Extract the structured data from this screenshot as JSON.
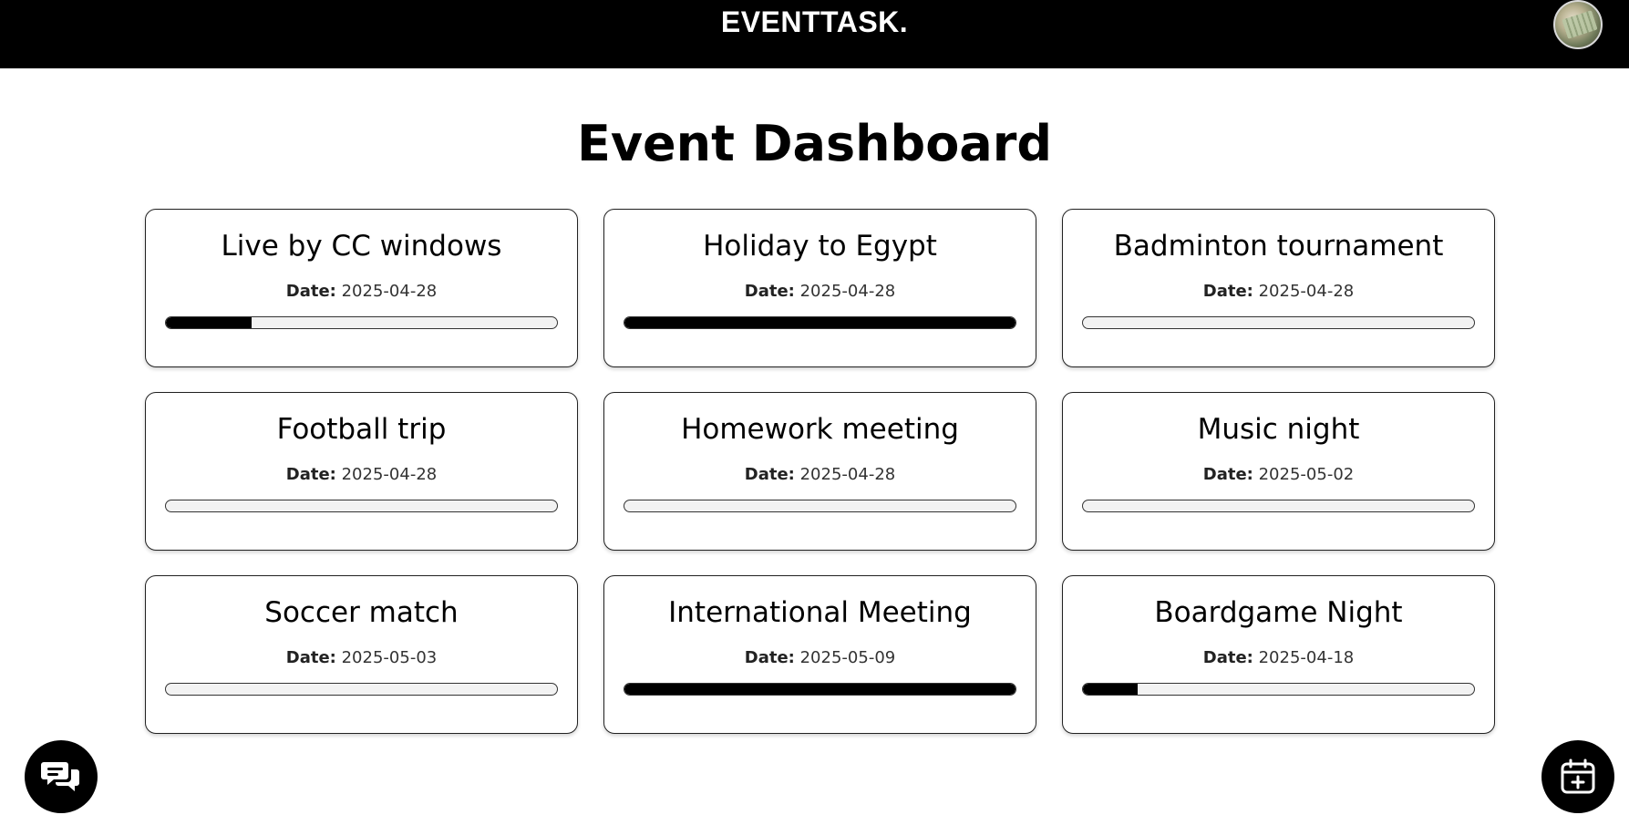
{
  "header": {
    "brand": "EVENTTASK.",
    "avatar_icon": "user-avatar-icon",
    "background": "#000000"
  },
  "main": {
    "title": "Event Dashboard",
    "date_label": "Date:",
    "events": [
      {
        "name": "Live by CC windows",
        "date": "2025-04-28",
        "progress": 0.22
      },
      {
        "name": "Holiday to Egypt",
        "date": "2025-04-28",
        "progress": 1.0
      },
      {
        "name": "Badminton tournament",
        "date": "2025-04-28",
        "progress": 0.0
      },
      {
        "name": "Football trip",
        "date": "2025-04-28",
        "progress": 0.0
      },
      {
        "name": "Homework meeting",
        "date": "2025-04-28",
        "progress": 0.0
      },
      {
        "name": "Music night",
        "date": "2025-05-02",
        "progress": 0.0
      },
      {
        "name": "Soccer match",
        "date": "2025-05-03",
        "progress": 0.0
      },
      {
        "name": "International Meeting",
        "date": "2025-05-09",
        "progress": 1.0
      },
      {
        "name": "Boardgame Night",
        "date": "2025-04-18",
        "progress": 0.14
      }
    ]
  },
  "actions": {
    "chat_icon": "chat-bubbles-icon",
    "add_event_icon": "calendar-plus-icon"
  },
  "colors": {
    "accent": "#000000",
    "progress_track": "#f2f2f2"
  }
}
